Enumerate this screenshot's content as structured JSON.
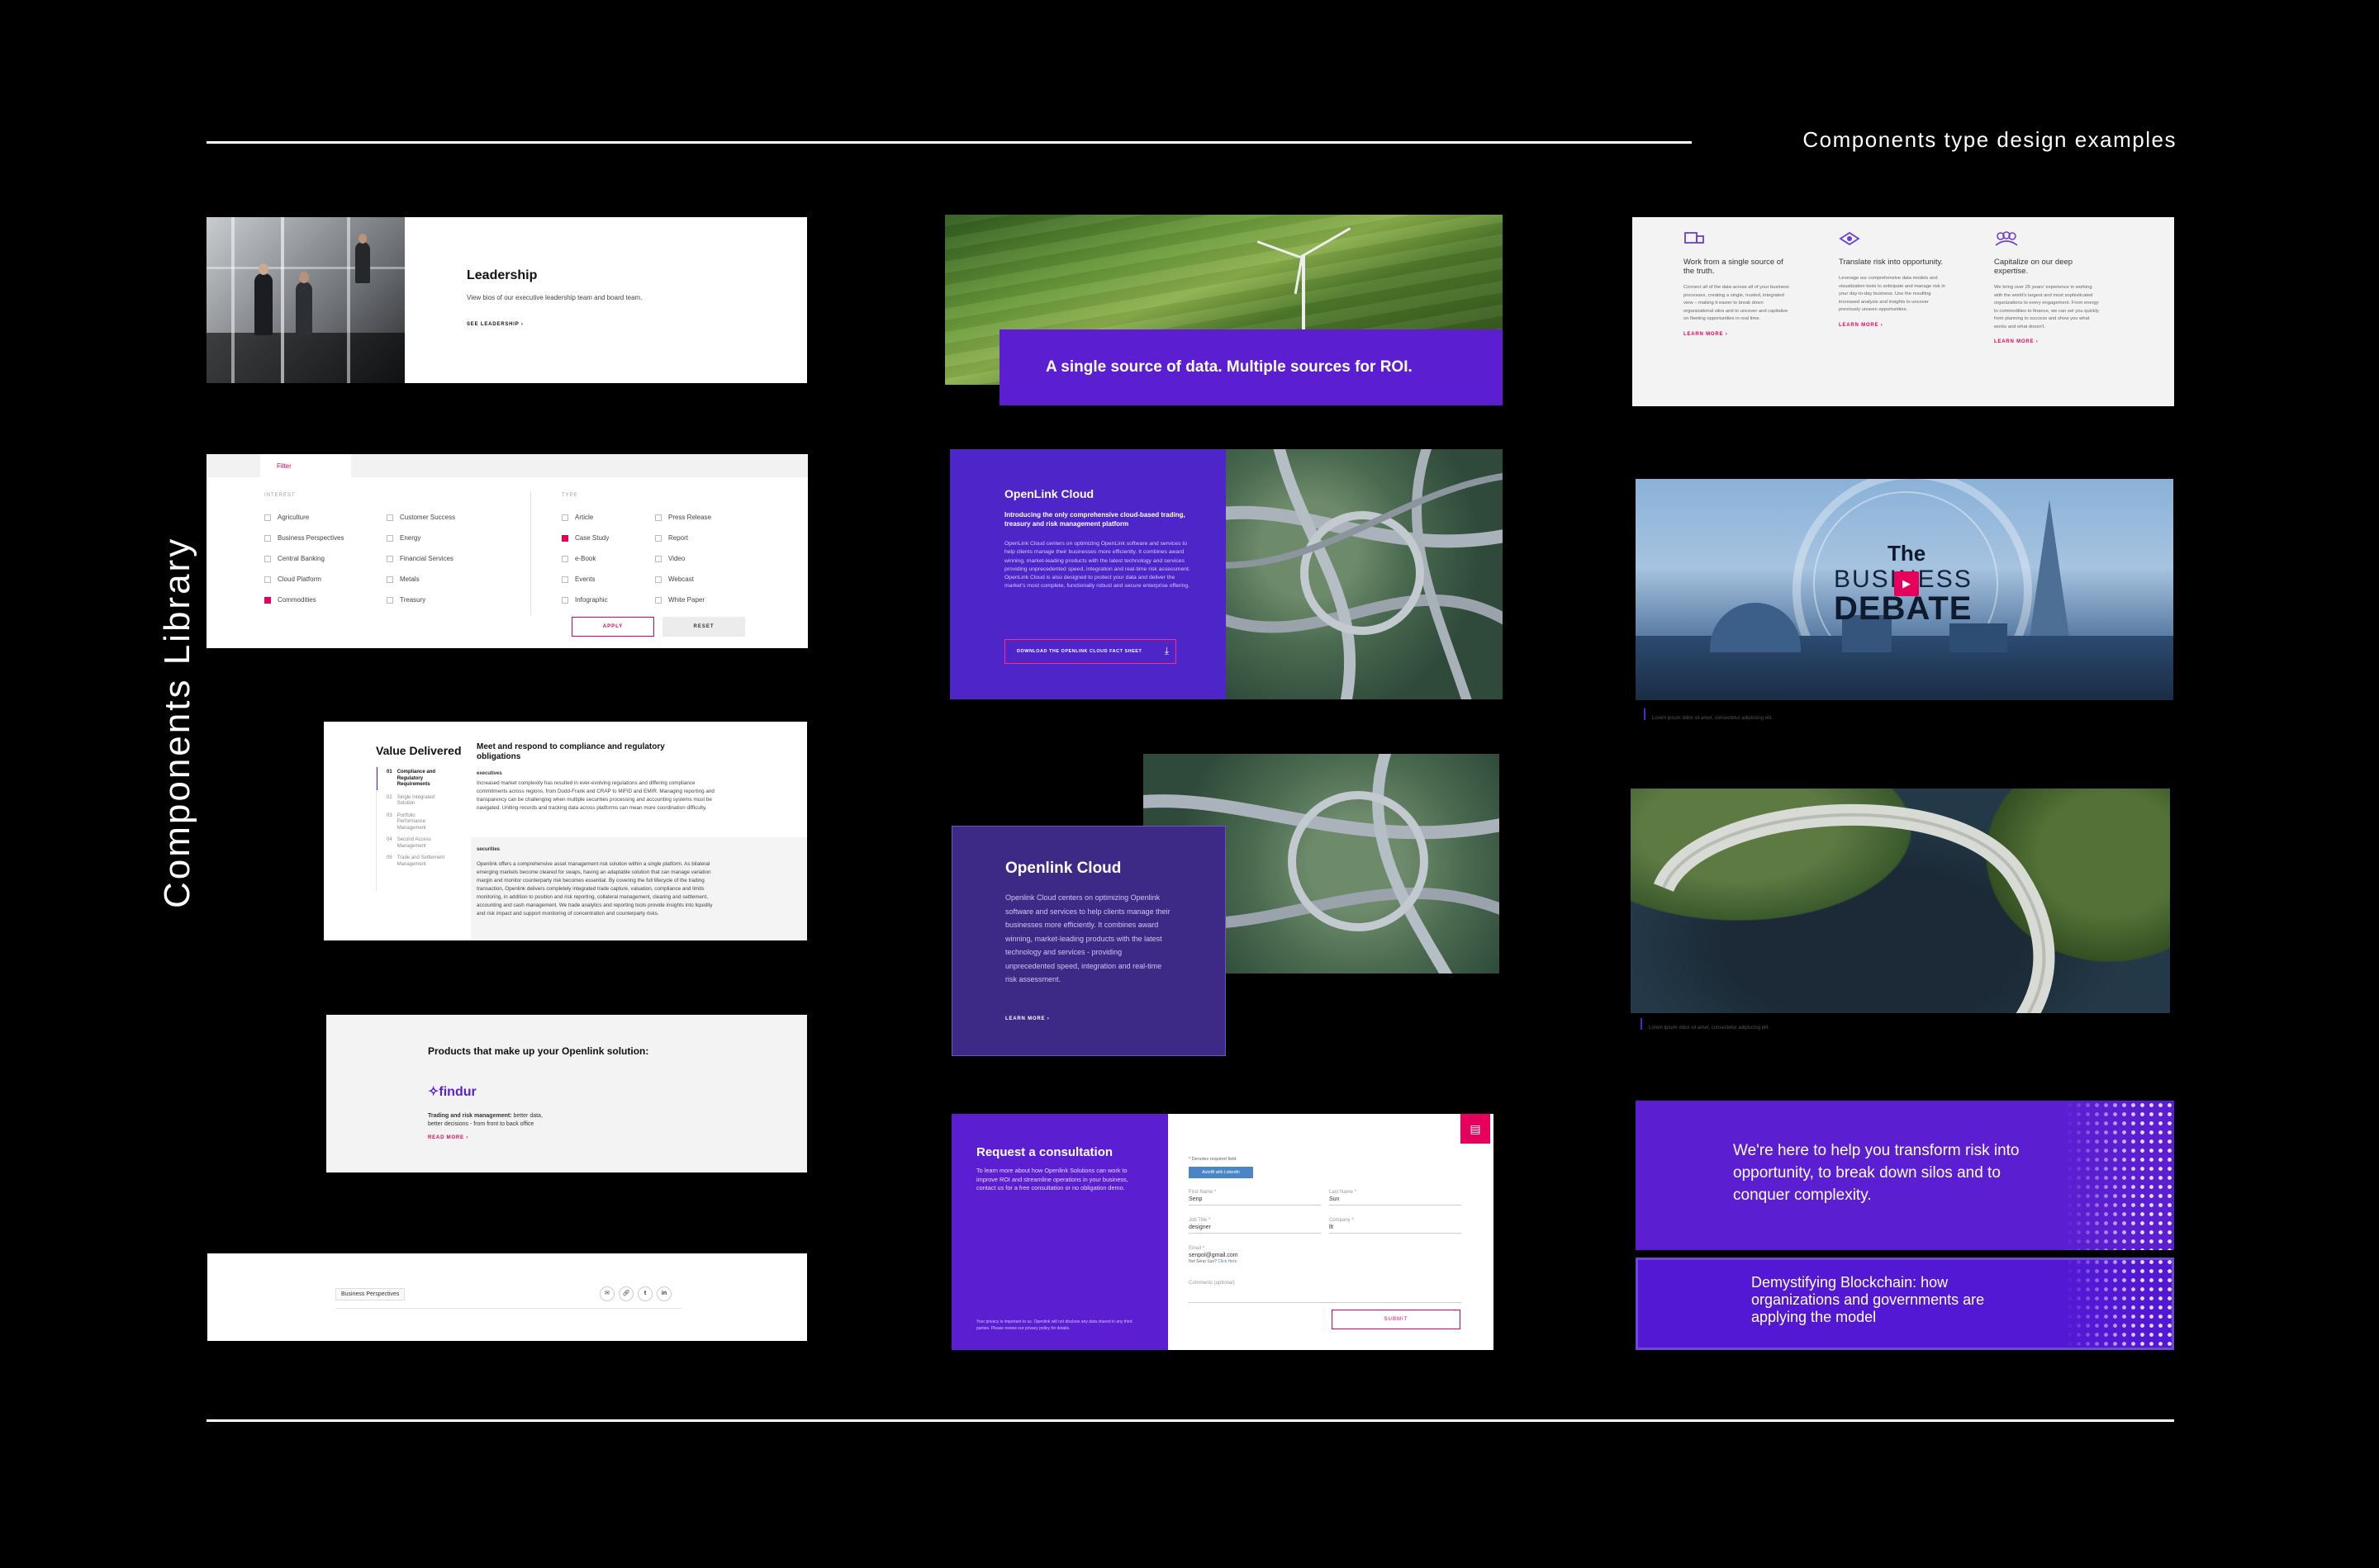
{
  "page": {
    "heading": "Components type design examples",
    "vertical_title": "Components Library"
  },
  "leadership": {
    "title": "Leadership",
    "desc": "View bios of our executive leadership team and board team.",
    "link": "SEE LEADERSHIP ›"
  },
  "filter": {
    "tab_label": "Filter",
    "interest_heading": "INTEREST",
    "type_heading": "TYPE",
    "interest_col1": [
      {
        "label": "Agriculture",
        "checked": false
      },
      {
        "label": "Business Perspectives",
        "checked": false
      },
      {
        "label": "Central Banking",
        "checked": false
      },
      {
        "label": "Cloud Platform",
        "checked": false
      },
      {
        "label": "Commodities",
        "checked": true
      }
    ],
    "interest_col2": [
      {
        "label": "Customer Success",
        "checked": false
      },
      {
        "label": "Energy",
        "checked": false
      },
      {
        "label": "Financial Services",
        "checked": false
      },
      {
        "label": "Metals",
        "checked": false
      },
      {
        "label": "Treasury",
        "checked": false
      }
    ],
    "type_col1": [
      {
        "label": "Article",
        "checked": false
      },
      {
        "label": "Case Study",
        "checked": true
      },
      {
        "label": "e-Book",
        "checked": false
      },
      {
        "label": "Events",
        "checked": false
      },
      {
        "label": "Infographic",
        "checked": false
      }
    ],
    "type_col2": [
      {
        "label": "Press Release",
        "checked": false
      },
      {
        "label": "Report",
        "checked": false
      },
      {
        "label": "Video",
        "checked": false
      },
      {
        "label": "Webcast",
        "checked": false
      },
      {
        "label": "White Paper",
        "checked": false
      }
    ],
    "apply_label": "APPLY",
    "reset_label": "RESET"
  },
  "value": {
    "title": "Value Delivered",
    "headline": "Meet and respond to compliance and regulatory obligations",
    "tabs": [
      {
        "num": "01",
        "label": "Compliance and Regulatory Requirements"
      },
      {
        "num": "02",
        "label": "Single Integrated Solution"
      },
      {
        "num": "03",
        "label": "Portfolio Performance Management"
      },
      {
        "num": "04",
        "label": "Second Access Management"
      },
      {
        "num": "05",
        "label": "Trade and Settlement Management"
      }
    ],
    "section1_label": "executives",
    "section1_text": "Increased market complexity has resulted in ever-evolving regulations and differing compliance commitments across regions, from Dodd-Frank and CRAP to MiFID and EMIR. Managing reporting and transparency can be challenging when multiple securities processing and accounting systems must be navigated. Uniting records and tracking data across platforms can mean more coordination difficulty.",
    "section2_label": "securities",
    "section2_text": "Openlink offers a comprehensive asset management risk solution within a single platform. As bilateral emerging markets become cleared for swaps, having an adaptable solution that can manage variation margin and monitor counterparty risk becomes essential. By covering the full lifecycle of the trading transaction, Openlink delivers completely integrated trade capture, valuation, compliance and limits monitoring, in addition to position and risk reporting, collateral management, clearing and settlement, accounting and cash management. We trade analytics and reporting tools provide insights into liquidity and risk impact and support monitoring of concentration and counterparty risks."
  },
  "products": {
    "title": "Products that make up your Openlink solution:",
    "logo": "findur",
    "text_bold": "Trading and risk management:",
    "text": " better data, better decisions - from front to back office",
    "link": "READ MORE ›"
  },
  "share": {
    "tag": "Business Perspectives",
    "icons": [
      "email-icon",
      "link-icon",
      "twitter-icon",
      "linkedin-icon"
    ]
  },
  "hero": {
    "banner_text": "A single source of data. Multiple sources for ROI."
  },
  "openlink1": {
    "title": "OpenLink Cloud",
    "subtitle": "Introducing the only comprehensive cloud-based trading, treasury and risk management platform",
    "text": "OpenLink Cloud centers on optimizing OpenLink software and services to help clients manage their businesses more efficiently. It combines award winning, market-leading products with the latest technology and services providing unprecedented speed, integration and real-time risk assessment. OpenLink Cloud is also designed to protect your data and deliver the market's most complete, functionally robust and secure enterprise offering.",
    "button": "DOWNLOAD THE OPENLINK CLOUD FACT SHEET"
  },
  "openlink2": {
    "title": "Openlink Cloud",
    "text": "Openlink Cloud centers on optimizing Openlink software and services to help clients manage their businesses more efficiently. It combines award winning, market-leading products with the latest technology and services - providing unprecedented speed, integration and real-time risk assessment.",
    "link": "LEARN MORE ›"
  },
  "consult": {
    "title": "Request a consultation",
    "text": "To learn more about how Openlink Solutions can work to improve ROI and streamline operations in your business, contact us for a free consultation or no obligation demo.",
    "footnote": "Your privacy is important to us. Openlink will not disclose any data shared in any third parties. Please review our privacy policy for details.",
    "required": "* Denotes required field",
    "autofill": "Autofill with LinkedIn",
    "fields": {
      "first_label": "First Name *",
      "first_val": "Senp",
      "last_label": "Last Name *",
      "last_val": "Sun",
      "job_label": "Job Title *",
      "job_val": "designer",
      "company_label": "Company *",
      "company_val": "llt",
      "email_label": "Email *",
      "email_val": "senpol@gmail.com",
      "notsenp": "Not Senp Sun?",
      "clickhere": "Click Here",
      "comments_label": "Comments (optional)"
    },
    "submit": "SUBMIT"
  },
  "features": {
    "items": [
      {
        "icon": "data-source-icon",
        "title": "Work from a single source of the truth.",
        "text": "Connect all of the data across all of your business processes, creating a single, trusted, integrated view – making it easier to break down organizational silos and to uncover and capitalize on fleeting opportunities in real time.",
        "link": "LEARN MORE ›"
      },
      {
        "icon": "risk-eye-icon",
        "title": "Translate risk into opportunity.",
        "text": "Leverage our comprehensive data models and visualization tools to anticipate and manage risk in your day-to-day business. Use the resulting increased analysis and insights to uncover previously unseen opportunities.",
        "link": "LEARN MORE ›"
      },
      {
        "icon": "people-icon",
        "title": "Capitalize on our deep expertise.",
        "text": "We bring over 25 years' experience in working with the world's largest and most sophisticated organizations to every engagement. From energy to commodities to finance, we can set you quickly from planning to success and show you what works and what doesn't.",
        "link": "LEARN MORE ›"
      }
    ]
  },
  "video": {
    "title_the": "The",
    "title_business": "BUSINESS",
    "title_debate": "DEBATE",
    "caption": "Lorem ipsum dolor sit amet, consectetur adipiscing elit."
  },
  "aerial": {
    "caption": "Lorem ipsum dolor sit amet, consectetur adipiscing elit."
  },
  "cta1": {
    "text": "We're here to help you transform risk into opportunity, to break down silos and to conquer complexity."
  },
  "cta2": {
    "text": "Demystifying Blockchain: how organizations and governments are applying the model"
  },
  "colors": {
    "accent": "#e6005c",
    "purple": "#5b1fd1",
    "purple_dark": "#3d2a86"
  }
}
